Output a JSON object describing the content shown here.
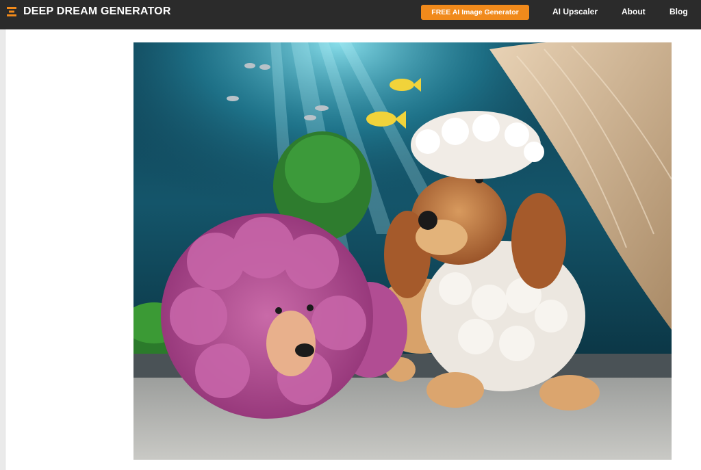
{
  "header": {
    "brand_title": "DEEP DREAM GENERATOR",
    "logo_icon": "stacked-bars-logo-icon",
    "cta_label": "FREE AI Image Generator",
    "nav": [
      {
        "label": "AI Upscaler"
      },
      {
        "label": "About"
      },
      {
        "label": "Blog"
      }
    ]
  },
  "colors": {
    "header_bg": "#2b2b2b",
    "accent": "#f18a1b",
    "page_bg": "#ffffff"
  },
  "artwork": {
    "alt": "Two poodles lying on a floor in front of an aquarium: one with pink curly fur, one apricot with a white fluffy wool coat and hat; fish and a tree in the water behind."
  }
}
